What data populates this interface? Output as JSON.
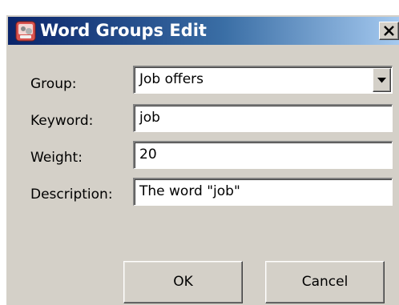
{
  "window": {
    "title": "Word Groups Edit",
    "app_icon": "app-icon",
    "close_icon": "close-icon"
  },
  "form": {
    "group": {
      "label": "Group:",
      "value": "Job offers"
    },
    "keyword": {
      "label": "Keyword:",
      "value": "job"
    },
    "weight": {
      "label": "Weight:",
      "value": "20"
    },
    "description": {
      "label": "Description:",
      "value": "The word \"job\""
    }
  },
  "buttons": {
    "ok": "OK",
    "cancel": "Cancel"
  },
  "colors": {
    "title_bar_start": "#0a246a",
    "title_bar_end": "#a6caf0",
    "dialog_face": "#d4d0c8"
  }
}
